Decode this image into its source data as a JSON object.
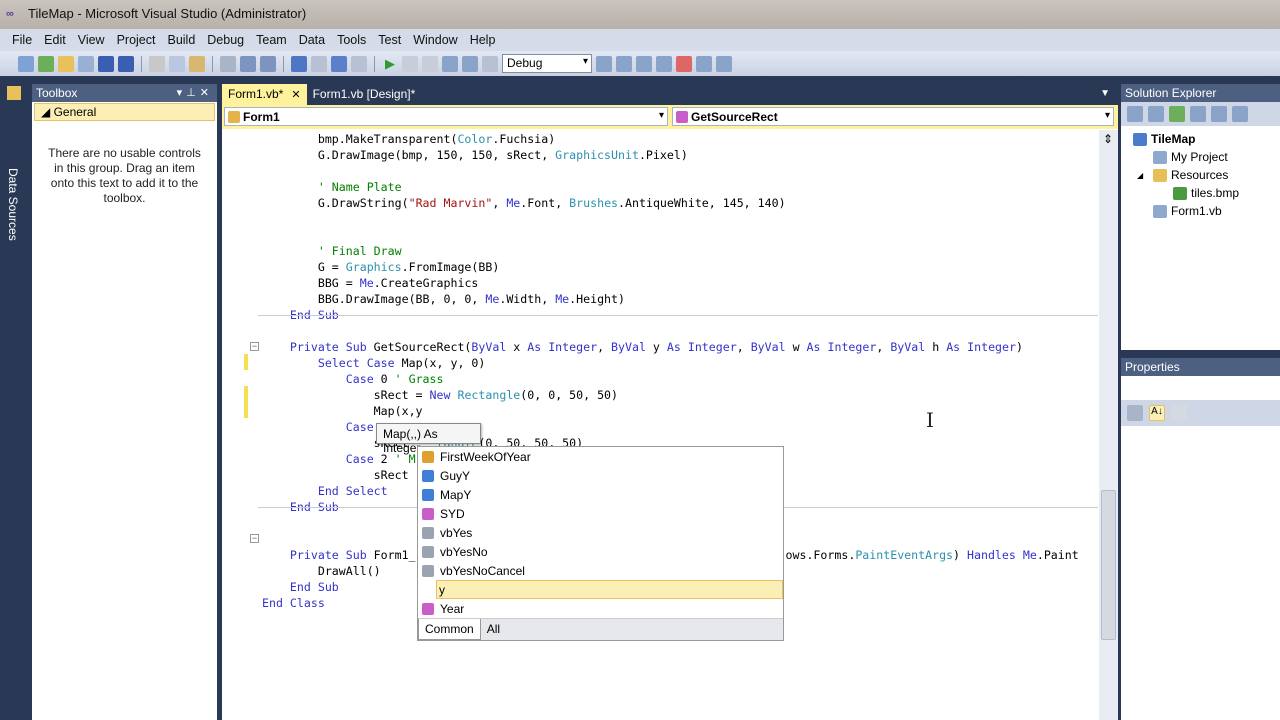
{
  "window": {
    "title": "TileMap - Microsoft Visual Studio (Administrator)"
  },
  "menu": [
    "File",
    "Edit",
    "View",
    "Project",
    "Build",
    "Debug",
    "Team",
    "Data",
    "Tools",
    "Test",
    "Window",
    "Help"
  ],
  "toolbar": {
    "configuration": "Debug"
  },
  "left_strip": {
    "label": "Data Sources"
  },
  "toolbox": {
    "title": "Toolbox",
    "group": "General",
    "empty_message": "There are no usable controls in this group. Drag an item onto this text to add it to the toolbox."
  },
  "editor": {
    "tabs": [
      {
        "label": "Form1.vb*",
        "active": true
      },
      {
        "label": "Form1.vb [Design]*",
        "active": false
      }
    ],
    "class_combo": "Form1",
    "method_combo": "GetSourceRect"
  },
  "code": {
    "lines": [
      [
        [
          "        bmp.MakeTransparent(",
          ""
        ],
        [
          "Color",
          "t"
        ],
        [
          ".Fuchsia)",
          ""
        ]
      ],
      [
        [
          "        G.DrawImage(bmp, 150, 150, sRect, ",
          ""
        ],
        [
          "GraphicsUnit",
          "t"
        ],
        [
          ".Pixel)",
          ""
        ]
      ],
      [],
      [
        [
          "        ",
          ""
        ],
        [
          "' Name Plate",
          "c"
        ]
      ],
      [
        [
          "        G.DrawString(",
          ""
        ],
        [
          "\"Rad Marvin\"",
          "s"
        ],
        [
          ", ",
          ""
        ],
        [
          "Me",
          "k"
        ],
        [
          ".Font, ",
          ""
        ],
        [
          "Brushes",
          "t"
        ],
        [
          ".AntiqueWhite, 145, 140)",
          ""
        ]
      ],
      [],
      [],
      [
        [
          "        ",
          ""
        ],
        [
          "' Final Draw",
          "c"
        ]
      ],
      [
        [
          "        G = ",
          ""
        ],
        [
          "Graphics",
          "t"
        ],
        [
          ".FromImage(BB)",
          ""
        ]
      ],
      [
        [
          "        BBG = ",
          ""
        ],
        [
          "Me",
          "k"
        ],
        [
          ".CreateGraphics",
          ""
        ]
      ],
      [
        [
          "        BBG.DrawImage(BB, 0, 0, ",
          ""
        ],
        [
          "Me",
          "k"
        ],
        [
          ".Width, ",
          ""
        ],
        [
          "Me",
          "k"
        ],
        [
          ".Height)",
          ""
        ]
      ],
      [
        [
          "    ",
          ""
        ],
        [
          "End Sub",
          "k"
        ]
      ],
      [],
      [
        [
          "    ",
          ""
        ],
        [
          "Private Sub",
          "k"
        ],
        [
          " GetSourceRect(",
          ""
        ],
        [
          "ByVal",
          "k"
        ],
        [
          " x ",
          ""
        ],
        [
          "As Integer",
          "k"
        ],
        [
          ", ",
          ""
        ],
        [
          "ByVal",
          "k"
        ],
        [
          " y ",
          ""
        ],
        [
          "As Integer",
          "k"
        ],
        [
          ", ",
          ""
        ],
        [
          "ByVal",
          "k"
        ],
        [
          " w ",
          ""
        ],
        [
          "As Integer",
          "k"
        ],
        [
          ", ",
          ""
        ],
        [
          "ByVal",
          "k"
        ],
        [
          " h ",
          ""
        ],
        [
          "As Integer",
          "k"
        ],
        [
          ")",
          ""
        ]
      ],
      [
        [
          "        ",
          ""
        ],
        [
          "Select Case",
          "k"
        ],
        [
          " Map(x, y, 0)",
          ""
        ]
      ],
      [
        [
          "            ",
          ""
        ],
        [
          "Case",
          "k"
        ],
        [
          " 0 ",
          ""
        ],
        [
          "' Grass",
          "c"
        ]
      ],
      [
        [
          "                sRect = ",
          ""
        ],
        [
          "New",
          "k"
        ],
        [
          " ",
          ""
        ],
        [
          "Rectangle",
          "t"
        ],
        [
          "(0, 0, 50, 50)",
          ""
        ]
      ],
      [
        [
          "                Map(x,y",
          ""
        ]
      ],
      [
        [
          "            ",
          ""
        ],
        [
          "Case",
          "k"
        ]
      ],
      [
        [
          "                sRect    ",
          ""
        ],
        [
          "tangle",
          "t"
        ],
        [
          "(0, 50, 50, 50)",
          ""
        ]
      ],
      [
        [
          "            ",
          ""
        ],
        [
          "Case",
          "k"
        ],
        [
          " 2 ",
          ""
        ],
        [
          "' M",
          "c"
        ]
      ],
      [
        [
          "                sRect",
          ""
        ]
      ],
      [
        [
          "        ",
          ""
        ],
        [
          "End Select",
          "k"
        ]
      ],
      [
        [
          "    ",
          ""
        ],
        [
          "End Sub",
          "k"
        ]
      ],
      [],
      [],
      [
        [
          "    ",
          ""
        ],
        [
          "Private Sub",
          "k"
        ],
        [
          " Form1_                                                     ows.Forms.",
          ""
        ],
        [
          "PaintEventArgs",
          "t"
        ],
        [
          ") ",
          ""
        ],
        [
          "Handles",
          "k"
        ],
        [
          " ",
          ""
        ],
        [
          "Me",
          "k"
        ],
        [
          ".Paint",
          ""
        ]
      ],
      [
        [
          "        DrawAll()",
          ""
        ]
      ],
      [
        [
          "    ",
          ""
        ],
        [
          "End Sub",
          "k"
        ]
      ],
      [
        [
          "",
          ""
        ],
        [
          "End Class",
          "k"
        ]
      ]
    ]
  },
  "parameter_tooltip": "Map(,,) As Integer",
  "completion": {
    "items": [
      {
        "label": "FirstWeekOfYear",
        "icon": "enum-icon",
        "color": "#e0a030"
      },
      {
        "label": "GuyY",
        "icon": "shared-field-icon",
        "color": "#3f7fd8"
      },
      {
        "label": "MapY",
        "icon": "shared-field-icon",
        "color": "#3f7fd8"
      },
      {
        "label": "SYD",
        "icon": "method-icon",
        "color": "#c85fc8"
      },
      {
        "label": "vbYes",
        "icon": "constant-icon",
        "color": "#9aa4b0"
      },
      {
        "label": "vbYesNo",
        "icon": "constant-icon",
        "color": "#9aa4b0"
      },
      {
        "label": "vbYesNoCancel",
        "icon": "constant-icon",
        "color": "#9aa4b0"
      },
      {
        "label": "y",
        "icon": "field-icon",
        "color": "#3f7fd8",
        "selected": true
      },
      {
        "label": "Year",
        "icon": "method-icon",
        "color": "#c85fc8"
      }
    ],
    "tabs": [
      {
        "label": "Common",
        "active": true
      },
      {
        "label": "All",
        "active": false
      }
    ]
  },
  "solution_explorer": {
    "title": "Solution Explorer",
    "items": [
      {
        "label": "TileMap",
        "level": 0,
        "bold": true,
        "icon": "project-icon",
        "color": "#4a7cc9"
      },
      {
        "label": "My Project",
        "level": 1,
        "icon": "my-project-icon",
        "color": "#8fa8cc"
      },
      {
        "label": "Resources",
        "level": 1,
        "expanded": true,
        "icon": "folder-icon",
        "color": "#e8bf55"
      },
      {
        "label": "tiles.bmp",
        "level": 2,
        "icon": "bitmap-icon",
        "color": "#4c9a3f"
      },
      {
        "label": "Form1.vb",
        "level": 1,
        "icon": "form-icon",
        "color": "#8fa8cc"
      }
    ]
  },
  "properties": {
    "title": "Properties"
  },
  "colors": {
    "frame": "#293955",
    "active_tab": "#fff29d",
    "panel_header": "#4d6082",
    "keyword": "#3333cc",
    "type": "#2b91af",
    "comment": "#008000",
    "string": "#a31515"
  }
}
